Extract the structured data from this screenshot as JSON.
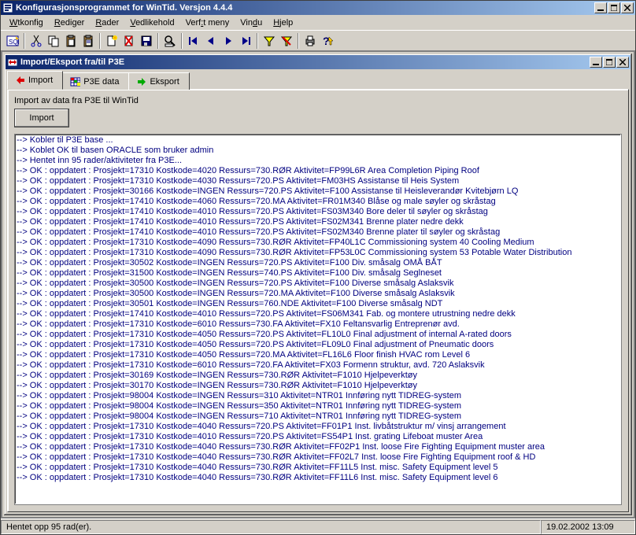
{
  "app": {
    "title": "Konfigurasjonsprogrammet for WinTid. Versjon 4.4.4",
    "menus": [
      {
        "label": "Wtkonfig",
        "u": 0
      },
      {
        "label": "Rediger",
        "u": 0
      },
      {
        "label": "Rader",
        "u": 0
      },
      {
        "label": "Vedlikehold",
        "u": 0
      },
      {
        "label": "Verf:t meny",
        "u": 4
      },
      {
        "label": "Vindu",
        "u": 3
      },
      {
        "label": "Hjelp",
        "u": 0
      }
    ]
  },
  "toolbar_icons": [
    "sql-icon",
    "sep",
    "cut-icon",
    "copy-icon",
    "paste-icon",
    "paste2-icon",
    "sep",
    "new-icon",
    "delete-icon",
    "save-icon",
    "sep",
    "find-icon",
    "sep",
    "first-icon",
    "prev-icon",
    "next-icon",
    "last-icon",
    "sep",
    "filter-icon",
    "clear-filter-icon",
    "sep",
    "print-icon",
    "help-icon"
  ],
  "child": {
    "title": "Import/Eksport fra/til P3E",
    "tabs": [
      {
        "id": "import",
        "label": "Import",
        "icon": "import-icon",
        "active": true
      },
      {
        "id": "p3edata",
        "label": "P3E data",
        "icon": "grid-icon",
        "active": false
      },
      {
        "id": "eksport",
        "label": "Eksport",
        "icon": "export-icon",
        "active": false
      }
    ],
    "panel": {
      "section_label": "Import av data fra P3E til WinTid",
      "import_button": "Import",
      "log": [
        "--> Kobler til P3E base ...",
        "--> Koblet OK til basen ORACLE som bruker admin",
        "--> Hentet inn 95 rader/aktiviteter fra P3E...",
        "--> OK : oppdatert : Prosjekt=17310 Kostkode=4020 Ressurs=730.RØR Aktivitet=FP99L6R Area Completion Piping Roof",
        "--> OK : oppdatert : Prosjekt=17310 Kostkode=4030 Ressurs=720.PS Aktivitet=FM03HS Assistanse til Heis System",
        "--> OK : oppdatert : Prosjekt=30166 Kostkode=INGEN Ressurs=720.PS Aktivitet=F100 Assistanse til Heisleverandør Kvitebjørn LQ",
        "--> OK : oppdatert : Prosjekt=17410 Kostkode=4060 Ressurs=720.MA Aktivitet=FR01M340 Blåse og male søyler og skråstag",
        "--> OK : oppdatert : Prosjekt=17410 Kostkode=4010 Ressurs=720.PS Aktivitet=FS03M340 Bore deler til søyler og skråstag",
        "--> OK : oppdatert : Prosjekt=17410 Kostkode=4010 Ressurs=720.PS Aktivitet=FS02M341 Brenne plater nedre dekk",
        "--> OK : oppdatert : Prosjekt=17410 Kostkode=4010 Ressurs=720.PS Aktivitet=FS02M340 Brenne plater til søyler og skråstag",
        "--> OK : oppdatert : Prosjekt=17310 Kostkode=4090 Ressurs=730.RØR Aktivitet=FP40L1C Commissioning system 40 Cooling Medium",
        "--> OK : oppdatert : Prosjekt=17310 Kostkode=4090 Ressurs=730.RØR Aktivitet=FP53L0C Commissioning system 53 Potable Water Distribution",
        "--> OK : oppdatert : Prosjekt=30502 Kostkode=INGEN Ressurs=720.PS Aktivitet=F100 Div. småsalg OMÅ BÅT",
        "--> OK : oppdatert : Prosjekt=31500 Kostkode=INGEN Ressurs=740.PS Aktivitet=F100 Div. småsalg Seglneset",
        "--> OK : oppdatert : Prosjekt=30500 Kostkode=INGEN Ressurs=720.PS Aktivitet=F100 Diverse småsalg Aslaksvik",
        "--> OK : oppdatert : Prosjekt=30500 Kostkode=INGEN Ressurs=720.MA Aktivitet=F100 Diverse småsalg Aslaksvik",
        "--> OK : oppdatert : Prosjekt=30501 Kostkode=INGEN Ressurs=760.NDE Aktivitet=F100 Diverse småsalg NDT",
        "--> OK : oppdatert : Prosjekt=17410 Kostkode=4010 Ressurs=720.PS Aktivitet=FS06M341 Fab. og montere utrustning nedre dekk",
        "--> OK : oppdatert : Prosjekt=17310 Kostkode=6010 Ressurs=730.FA Aktivitet=FX10 Feltansvarlig Entreprenør avd.",
        "--> OK : oppdatert : Prosjekt=17310 Kostkode=4050 Ressurs=720.PS Aktivitet=FL10L0 Final adjustment of internal A-rated doors",
        "--> OK : oppdatert : Prosjekt=17310 Kostkode=4050 Ressurs=720.PS Aktivitet=FL09L0 Final adjustment of Pneumatic doors",
        "--> OK : oppdatert : Prosjekt=17310 Kostkode=4050 Ressurs=720.MA Aktivitet=FL16L6 Floor finish HVAC rom Level 6",
        "--> OK : oppdatert : Prosjekt=17310 Kostkode=6010 Ressurs=720.FA Aktivitet=FX03 Formenn struktur, avd. 720 Aslaksvik",
        "--> OK : oppdatert : Prosjekt=30169 Kostkode=INGEN Ressurs=730.RØR Aktivitet=F1010 Hjelpeverktøy",
        "--> OK : oppdatert : Prosjekt=30170 Kostkode=INGEN Ressurs=730.RØR Aktivitet=F1010 Hjelpeverktøy",
        "--> OK : oppdatert : Prosjekt=98004 Kostkode=INGEN Ressurs=310 Aktivitet=NTR01 Innføring nytt TIDREG-system",
        "--> OK : oppdatert : Prosjekt=98004 Kostkode=INGEN Ressurs=350 Aktivitet=NTR01 Innføring nytt TIDREG-system",
        "--> OK : oppdatert : Prosjekt=98004 Kostkode=INGEN Ressurs=710 Aktivitet=NTR01 Innføring nytt TIDREG-system",
        "--> OK : oppdatert : Prosjekt=17310 Kostkode=4040 Ressurs=720.PS Aktivitet=FF01P1 Inst.  livbåtstruktur m/ vinsj arrangement",
        "--> OK : oppdatert : Prosjekt=17310 Kostkode=4010 Ressurs=720.PS Aktivitet=FS54P1 Inst. grating Lifeboat muster Area",
        "--> OK : oppdatert : Prosjekt=17310 Kostkode=4040 Ressurs=730.RØR Aktivitet=FF02P1 Inst. loose Fire Fighting Equipment muster area",
        "--> OK : oppdatert : Prosjekt=17310 Kostkode=4040 Ressurs=730.RØR Aktivitet=FF02L7 Inst. loose Fire Fighting Equipment roof & HD",
        "--> OK : oppdatert : Prosjekt=17310 Kostkode=4040 Ressurs=730.RØR Aktivitet=FF11L5 Inst. misc. Safety Equipment level 5",
        "--> OK : oppdatert : Prosjekt=17310 Kostkode=4040 Ressurs=730.RØR Aktivitet=FF11L6 Inst. misc. Safety Equipment level 6"
      ]
    }
  },
  "status": {
    "main": "Hentet opp 95 rad(er).",
    "time": "19.02.2002 13:09"
  }
}
